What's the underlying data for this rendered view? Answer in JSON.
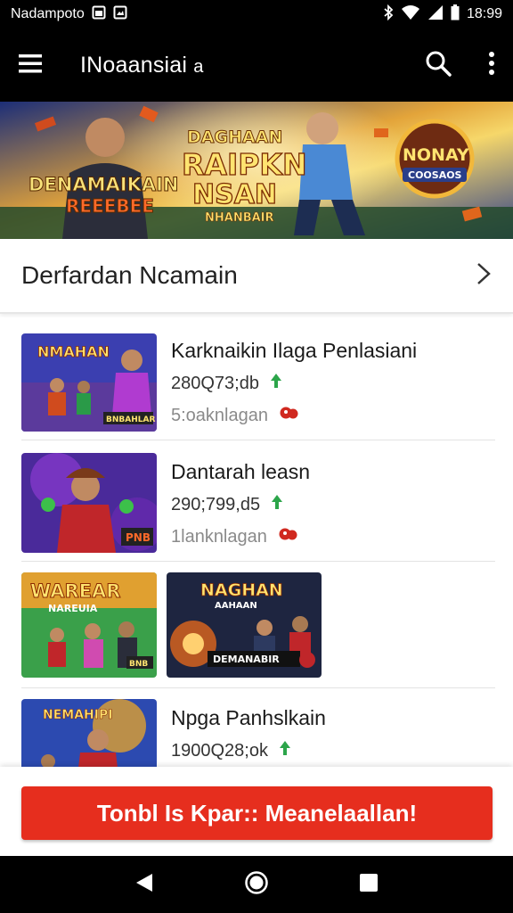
{
  "status_bar": {
    "carrier": "Nadampoto",
    "time": "18:99",
    "icons": [
      "image-icon",
      "gallery-icon",
      "bluetooth-icon",
      "wifi-icon",
      "signal-icon",
      "battery-icon"
    ]
  },
  "app_bar": {
    "title": "INoaansiai",
    "title_suffix": "a",
    "icons": [
      "menu-icon",
      "search-icon",
      "more-vert-icon"
    ]
  },
  "banner": {
    "left_text_line1": "DENAMAIKAIN",
    "left_text_line2": "REEEBEE",
    "center_text_line1": "DAGHAAN",
    "center_text_line2": "RAIPKN",
    "center_text_line3": "NSAN",
    "center_text_line4": "NHANBAIR",
    "badge_text_line1": "NONAY",
    "badge_text_line2": "COOSAOS"
  },
  "section": {
    "title": "Derfardan Ncamain"
  },
  "items": [
    {
      "title": "Karknaikin Ilaga Penlasiani",
      "count": "280Q73;db",
      "sub": "5:oaknlagan",
      "thumb_text": "NMAHAN",
      "thumb_badge": "BNBAHLAR"
    },
    {
      "title": "Dantarah leasn",
      "count": "290;799,d5",
      "sub": "1lanknlagan",
      "thumb_badge": "PNB"
    },
    {
      "thumb1_text_line1": "WAREAR",
      "thumb1_text_line2": "NAREUIA",
      "thumb1_badge": "BNB",
      "thumb2_text_line1": "NAGHAN",
      "thumb2_text_line2": "AAHAAN",
      "thumb2_badge": "DEMANABIR"
    },
    {
      "title": "Npga Panhslkain",
      "count": "1900Q28;ok",
      "thumb_text": "NEMAHIPI"
    }
  ],
  "cta": {
    "label": "Tonbl Is Kpar:: Meanelaallan!"
  },
  "nav_bar": {
    "icons": [
      "back-icon",
      "home-icon",
      "recents-icon"
    ]
  },
  "colors": {
    "accent": "#e62e1e",
    "bar": "#000000",
    "up_arrow": "#2ca54a",
    "pin": "#d0281f"
  }
}
